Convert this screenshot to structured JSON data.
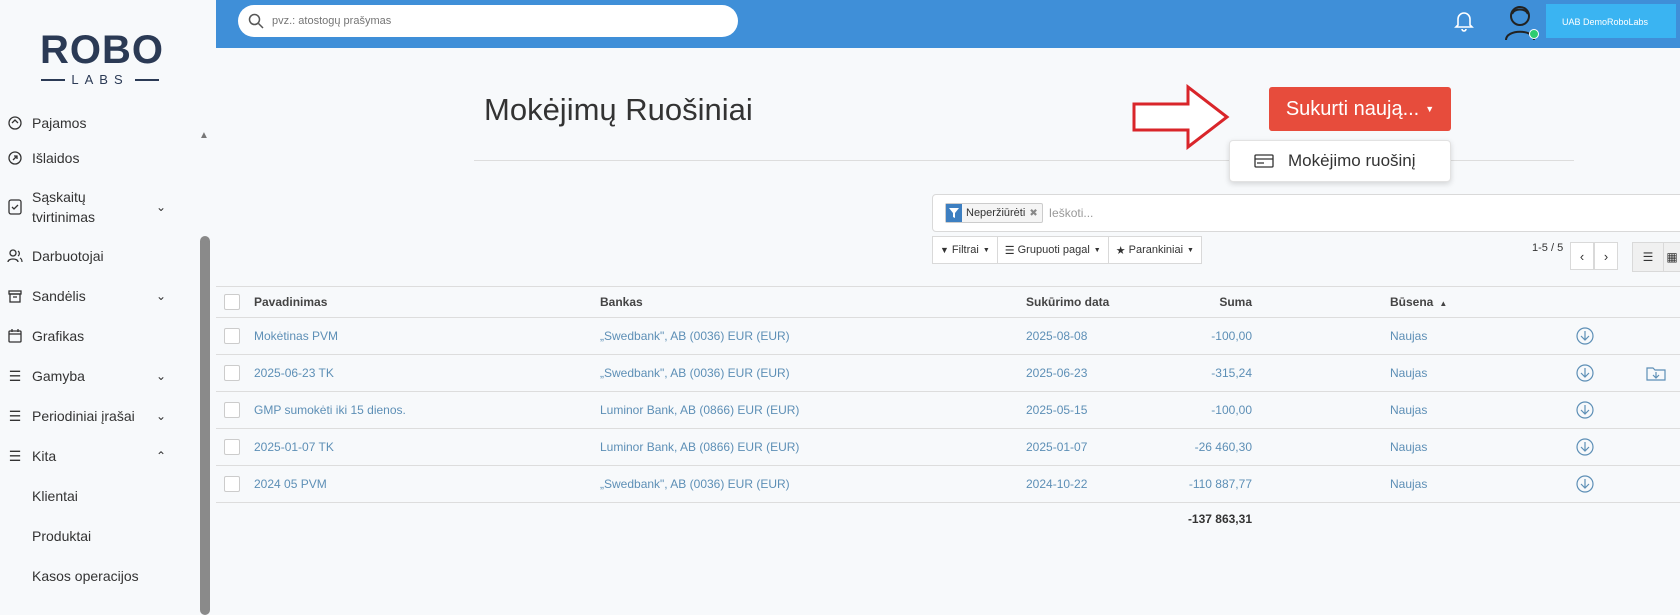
{
  "logo": {
    "top": "ROBO",
    "sub": "LABS"
  },
  "sidebar": {
    "items": [
      {
        "label": "Pajamos",
        "icon": "income-icon"
      },
      {
        "label": "Išlaidos",
        "icon": "expenses-icon"
      },
      {
        "label": "Sąskaitų tvirtinimas",
        "line1": "Sąskaitų",
        "line2": "tvirtinimas",
        "icon": "invoice-approval-icon"
      },
      {
        "label": "Darbuotojai",
        "icon": "employees-icon"
      },
      {
        "label": "Sandėlis",
        "icon": "warehouse-icon"
      },
      {
        "label": "Grafikas",
        "icon": "calendar-icon"
      },
      {
        "label": "Gamyba",
        "icon": "list-icon"
      },
      {
        "label": "Periodiniai įrašai",
        "icon": "list-icon"
      },
      {
        "label": "Kita",
        "icon": "list-icon"
      }
    ],
    "sub_items": [
      "Klientai",
      "Produktai",
      "Kasos operacijos"
    ]
  },
  "topbar": {
    "search_placeholder": "pvz.: atostogų prašymas",
    "company": "UAB DemoRoboLabs",
    "accent": "#3f8fd8"
  },
  "page": {
    "title": "Mokėjimų Ruošiniai",
    "create_button": "Sukurti naują...",
    "dropdown_item": "Mokėjimo ruošinį",
    "button_color": "#e74c3c"
  },
  "filters": {
    "facet": "Neperžiūrėti",
    "search_placeholder": "Ieškoti...",
    "filters_btn": "Filtrai",
    "group_btn": "Grupuoti pagal",
    "fav_btn": "Parankiniai",
    "pager": "1-5 / 5"
  },
  "table": {
    "headers": {
      "name": "Pavadinimas",
      "bank": "Bankas",
      "date": "Sukūrimo data",
      "sum": "Suma",
      "status": "Būsena"
    },
    "rows": [
      {
        "name": "Mokėtinas PVM",
        "bank": "„Swedbank\", AB (0036) EUR (EUR)",
        "date": "2025-08-08",
        "sum": "-100,00",
        "status": "Naujas"
      },
      {
        "name": "2025-06-23 TK",
        "bank": "„Swedbank\", AB (0036) EUR (EUR)",
        "date": "2025-06-23",
        "sum": "-315,24",
        "status": "Naujas"
      },
      {
        "name": "GMP sumokėti iki 15 dienos.",
        "bank": "Luminor Bank, AB (0866) EUR (EUR)",
        "date": "2025-05-15",
        "sum": "-100,00",
        "status": "Naujas"
      },
      {
        "name": "2025-01-07 TK",
        "bank": "Luminor Bank, AB (0866) EUR (EUR)",
        "date": "2025-01-07",
        "sum": "-26 460,30",
        "status": "Naujas"
      },
      {
        "name": "2024 05 PVM",
        "bank": "„Swedbank\", AB (0036) EUR (EUR)",
        "date": "2024-10-22",
        "sum": "-110 887,77",
        "status": "Naujas"
      }
    ],
    "total": "-137 863,31"
  }
}
